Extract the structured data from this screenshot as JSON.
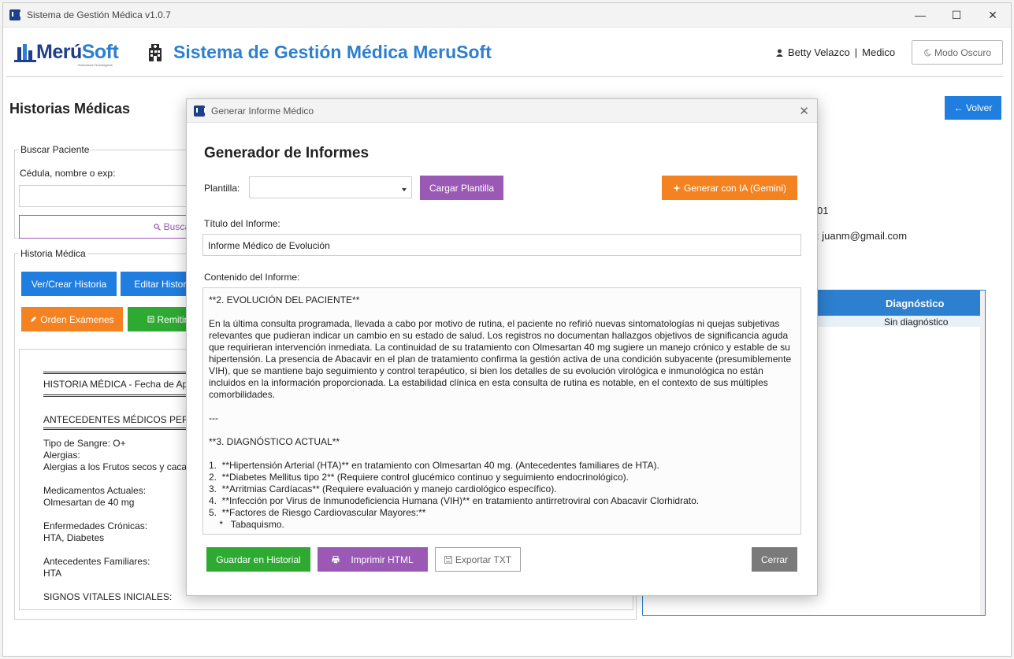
{
  "window": {
    "title": "Sistema de Gestión Médica v1.0.7",
    "controls": [
      "—",
      "☐",
      "✕"
    ]
  },
  "header": {
    "logo_main": "Merú",
    "logo_accent": "Soft",
    "logo_sub": "Soluciones Tecnológicas",
    "app_title": "Sistema de Gestión Médica MeruSoft",
    "user_name": "Betty Velazco",
    "separator": "|",
    "user_role": "Medico",
    "dark_mode": "Modo Oscuro"
  },
  "page": {
    "title": "Historias Médicas",
    "back": "← Volver"
  },
  "search": {
    "legend": "Buscar Paciente",
    "label": "Cédula, nombre o exp:",
    "button": "Buscar"
  },
  "history": {
    "legend": "Historia Médica",
    "buttons": {
      "view_create": "Ver/Crear Historia",
      "edit": "Editar Historia",
      "order_exams": "Orden Exámenes",
      "refer": "Remitir"
    },
    "lines": [
      "HISTORIA MÉDICA - Fecha de Ape",
      "ANTECEDENTES MÉDICOS PERSON",
      "Tipo de Sangre: O+",
      "Alergias:",
      "Alergias a los Frutos secos y cacahu",
      "Medicamentos Actuales:",
      "Olmesartan de 40 mg",
      "Enfermedades Crónicas:",
      "HTA, Diabetes",
      "Antecedentes Familiares:",
      "HTA",
      "SIGNOS VITALES INICIALES:"
    ]
  },
  "patient": {
    "partial_id": "01",
    "email": ": juanm@gmail.com"
  },
  "table": {
    "col_header": "Diagnóstico",
    "row_value": "Sin diagnóstico"
  },
  "modal": {
    "title": "Generar Informe Médico",
    "heading": "Generador de Informes",
    "template_label": "Plantilla:",
    "template_value": "",
    "load_template": "Cargar Plantilla",
    "generate_ai": "Generar con IA (Gemini)",
    "report_title_label": "Título del Informe:",
    "report_title_value": "Informe Médico de Evolución",
    "content_label": "Contenido del Informe:",
    "content_lines": [
      "**2. EVOLUCIÓN DEL PACIENTE**",
      "",
      "En la última consulta programada, llevada a cabo por motivo de rutina, el paciente no refirió nuevas sintomatologías ni quejas subjetivas",
      "relevantes que pudieran indicar un cambio en su estado de salud. Los registros no documentan hallazgos objetivos de significancia aguda",
      "que requirieran intervención inmediata. La continuidad de su tratamiento con Olmesartan 40 mg sugiere un manejo crónico y estable de su",
      "hipertensión. La presencia de Abacavir en el plan de tratamiento confirma la gestión activa de una condición subyacente (presumiblemente",
      "VIH), que se mantiene bajo seguimiento y control terapéutico, si bien los detalles de su evolución virológica e inmunológica no están",
      "incluidos en la información proporcionada. La estabilidad clínica en esta consulta de rutina es notable, en el contexto de sus múltiples",
      "comorbilidades.",
      "",
      "---",
      "",
      "**3. DIAGNÓSTICO ACTUAL**",
      "",
      "1.  **Hipertensión Arterial (HTA)** en tratamiento con Olmesartan 40 mg. (Antecedentes familiares de HTA).",
      "2.  **Diabetes Mellitus tipo 2** (Requiere control glucémico continuo y seguimiento endocrinológico).",
      "3.  **Arritmias Cardíacas** (Requiere evaluación y manejo cardiológico específico).",
      "4.  **Infección por Virus de Inmunodeficiencia Humana (VIH)** en tratamiento antirretroviral con Abacavir Clorhidrato.",
      "5.  **Factores de Riesgo Cardiovascular Mayores:**",
      "    *   Tabaquismo."
    ],
    "save": "Guardar en Historial",
    "print": "Imprimir HTML",
    "export": "Exportar TXT",
    "close": "Cerrar"
  },
  "colors": {
    "primary": "#1f7ee0",
    "orange": "#f58220",
    "green": "#2eaa33",
    "purple": "#9b59b6",
    "gray": "#7a7a7a",
    "title_blue": "#2d7fd0"
  },
  "icons": {
    "hospital": "hospital-icon",
    "user": "user-icon",
    "moon": "moon-icon",
    "search": "search-icon",
    "sparkle": "sparkle-icon",
    "printer": "printer-icon",
    "save": "save-icon",
    "pencil": "pencil-icon",
    "document": "document-icon"
  }
}
